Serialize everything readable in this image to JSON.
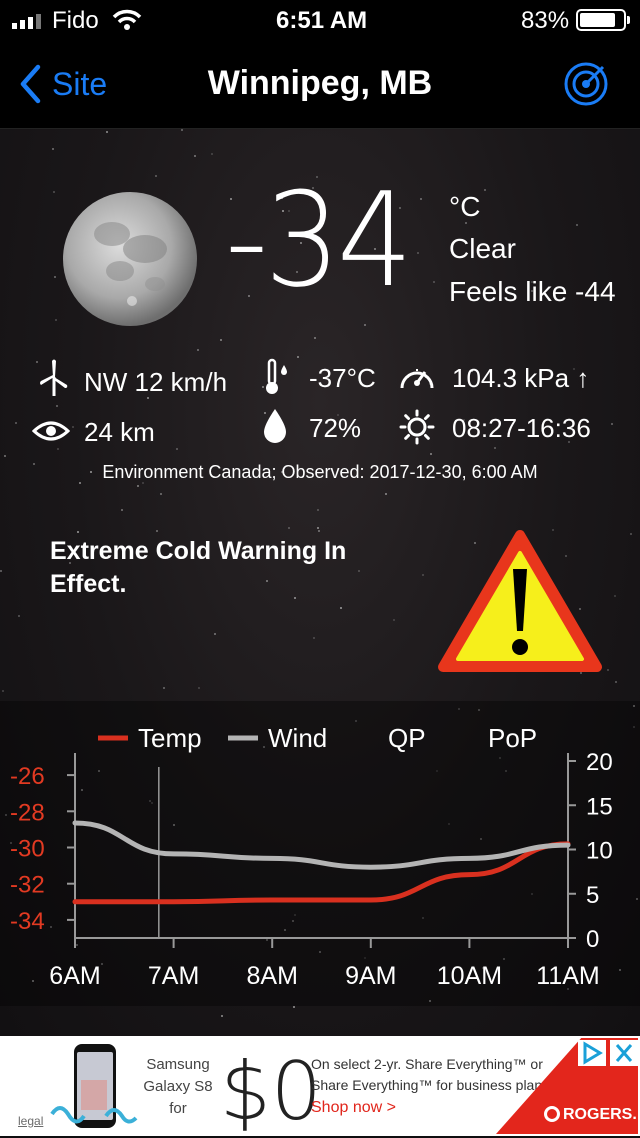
{
  "status": {
    "carrier": "Fido",
    "time": "6:51 AM",
    "battery": "83%",
    "battery_level": 0.83
  },
  "nav": {
    "back_label": "Site",
    "title": "Winnipeg, MB",
    "radar_icon": "radar-icon"
  },
  "current": {
    "icon": "moon-icon",
    "temperature": "-34",
    "unit": "°C",
    "condition": "Clear",
    "feels_like": "Feels like -44"
  },
  "details": {
    "wind": "NW 12 km/h",
    "dewpoint": "-37°C",
    "pressure": "104.3 kPa ↑",
    "visibility": "24 km",
    "humidity": "72%",
    "sun": "08:27-16:36"
  },
  "source": "Environment Canada; Observed: 2017-12-30, 6:00 AM",
  "warning": {
    "text": "Extreme Cold Warning In Effect.",
    "icon": "warning-triangle-icon"
  },
  "chart_data": {
    "type": "line",
    "legend": [
      "Temp",
      "Wind",
      "QP",
      "PoP"
    ],
    "x": [
      "6AM",
      "7AM",
      "8AM",
      "9AM",
      "10AM",
      "11AM"
    ],
    "left_ticks": [
      "-26",
      "-28",
      "-30",
      "-32",
      "-34"
    ],
    "right_ticks": [
      "20",
      "15",
      "10",
      "5",
      "0"
    ],
    "left_ylim": [
      -35,
      -25
    ],
    "right_ylim": [
      0,
      20
    ],
    "series": [
      {
        "name": "Temp",
        "axis": "left",
        "color": "#d9301f",
        "values": [
          -33,
          -33,
          -32.9,
          -32.9,
          -31.5,
          -29.8
        ]
      },
      {
        "name": "Wind",
        "axis": "right",
        "color": "#b4b4b4",
        "values": [
          13,
          9.5,
          9,
          8,
          9,
          10.5
        ]
      }
    ],
    "current_time_marker": "6:51 AM"
  },
  "ad": {
    "device": "Samsung Galaxy S8 for",
    "price": "$0",
    "offer_line1": "On select 2-yr. Share Everything™ or",
    "offer_line2": "Share Everything™ for business plans.",
    "cta": "Shop now >",
    "brand": "ROGERS.",
    "legal": "legal"
  }
}
